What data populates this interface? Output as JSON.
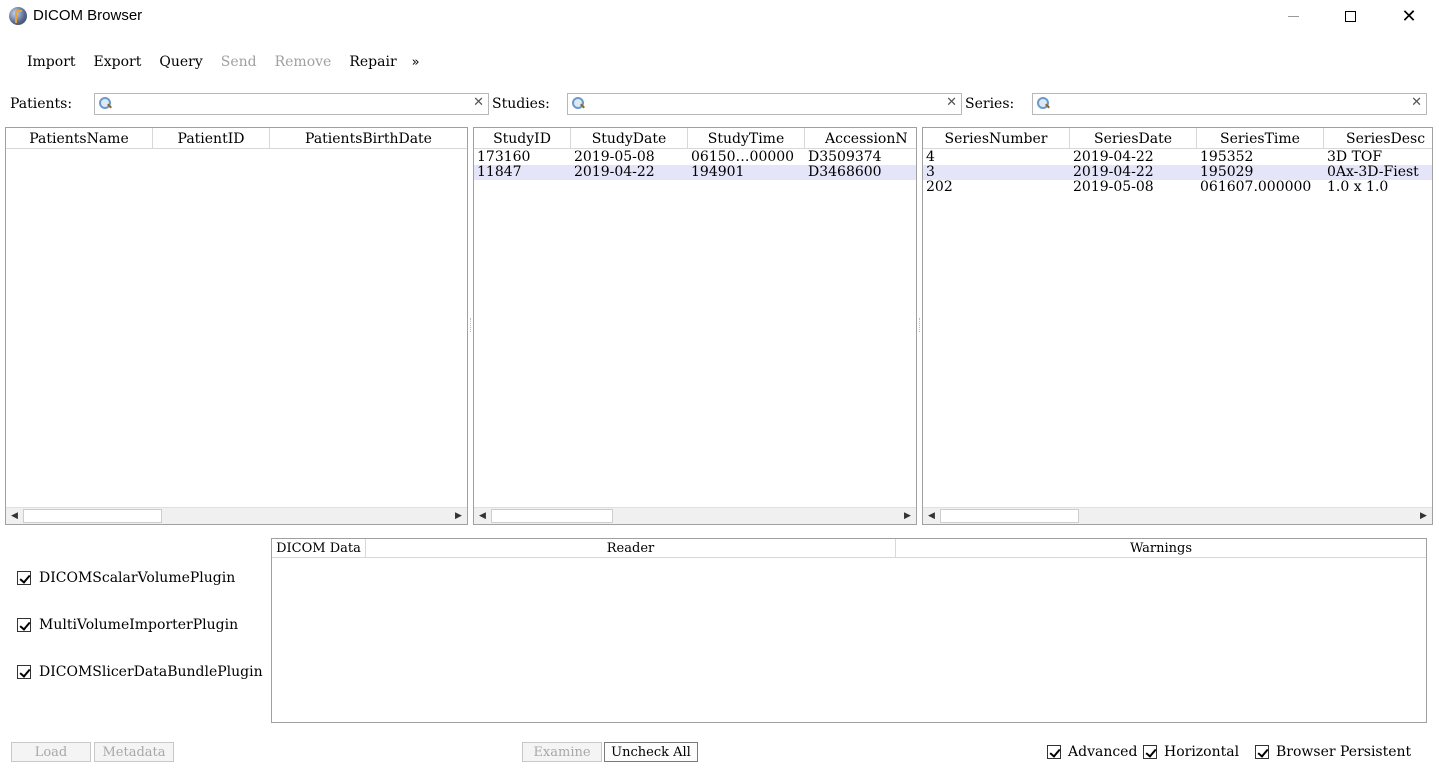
{
  "window": {
    "title": "DICOM Browser"
  },
  "toolbar": {
    "items": [
      {
        "label": "Import",
        "enabled": true
      },
      {
        "label": "Export",
        "enabled": true
      },
      {
        "label": "Query",
        "enabled": true
      },
      {
        "label": "Send",
        "enabled": false
      },
      {
        "label": "Remove",
        "enabled": false
      },
      {
        "label": "Repair",
        "enabled": true
      }
    ],
    "more": "»"
  },
  "search": {
    "patients_label": "Patients:",
    "studies_label": "Studies:",
    "series_label": "Series:",
    "patients_value": "",
    "studies_value": "",
    "series_value": "",
    "clear_glyph": "✕"
  },
  "patients": {
    "columns": [
      "PatientsName",
      "PatientID",
      "PatientsBirthDate"
    ],
    "rows": []
  },
  "studies": {
    "columns": [
      "StudyID",
      "StudyDate",
      "StudyTime",
      "AccessionN"
    ],
    "rows": [
      [
        "173160",
        "2019-05-08",
        "06150…00000",
        "D3509374"
      ],
      [
        "11847",
        "2019-04-22",
        "194901",
        "D3468600"
      ]
    ],
    "selected_row": 1
  },
  "series": {
    "columns": [
      "SeriesNumber",
      "SeriesDate",
      "SeriesTime",
      "SeriesDesc"
    ],
    "rows": [
      [
        "4",
        "2019-04-22",
        "195352",
        "3D TOF"
      ],
      [
        "3",
        "2019-04-22",
        "195029",
        "0Ax-3D-Fiest"
      ],
      [
        "202",
        "2019-05-08",
        "061607.000000",
        "1.0 x 1.0"
      ]
    ],
    "selected_row": 1
  },
  "plugins": [
    {
      "label": "DICOMScalarVolumePlugin",
      "checked": true
    },
    {
      "label": "MultiVolumeImporterPlugin",
      "checked": true
    },
    {
      "label": "DICOMSlicerDataBundlePlugin",
      "checked": true
    }
  ],
  "loadables": {
    "columns": [
      "DICOM Data",
      "Reader",
      "Warnings"
    ]
  },
  "buttons": {
    "load": "Load",
    "metadata": "Metadata",
    "examine": "Examine",
    "uncheck_all": "Uncheck All"
  },
  "options": [
    {
      "label": "Advanced",
      "checked": true
    },
    {
      "label": "Horizontal",
      "checked": true
    },
    {
      "label": "Browser Persistent",
      "checked": true
    }
  ],
  "colors": {
    "selected_row": "#e5e5fa",
    "disabled_text": "#a0a0a0",
    "border": "#a0a0a0"
  }
}
